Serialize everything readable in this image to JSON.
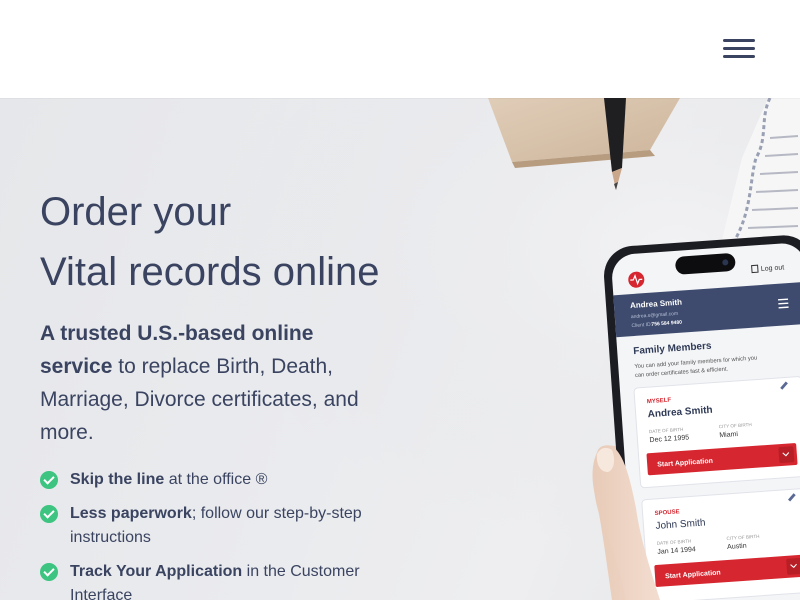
{
  "header": {
    "menu_icon": "hamburger-menu-icon"
  },
  "hero": {
    "title_line1": "Order your",
    "title_line2": "Vital records online",
    "desc_bold": "A trusted U.S.-based online service",
    "desc_rest": " to replace Birth, Death, Marriage, Divorce certificates, and more.",
    "features": [
      {
        "bold": "Skip the line",
        "rest": " at the office ®"
      },
      {
        "bold": "Less paperwork",
        "rest": "; follow our step-by-step instructions"
      },
      {
        "bold": "Track Your Application",
        "rest": " in the Customer Interface"
      }
    ]
  },
  "phone": {
    "logout": "Log out",
    "user_name": "Andrea Smith",
    "user_email": "andrea.s@gmail.com",
    "client_id_label": "Client ID:",
    "client_id": "756 584 9480",
    "section_title": "Family Members",
    "section_desc_1": "You can add your family members for which you",
    "section_desc_2": "can order certificates fast & efficient.",
    "cards": [
      {
        "relation": "MYSELF",
        "name": "Andrea Smith",
        "dob_label": "DATE OF BIRTH",
        "dob": "Dec 12 1995",
        "city_label": "CITY OF BIRTH",
        "city": "Miami",
        "button": "Start Application"
      },
      {
        "relation": "SPOUSE",
        "name": "John Smith",
        "dob_label": "DATE OF BIRTH",
        "dob": "Jan 14 1994",
        "city_label": "CITY OF BIRTH",
        "city": "Austin",
        "button": "Start Application"
      }
    ]
  },
  "colors": {
    "text": "#3a4461",
    "check": "#3cc480",
    "app_header": "#3e4b6e",
    "app_red": "#d6262f"
  }
}
